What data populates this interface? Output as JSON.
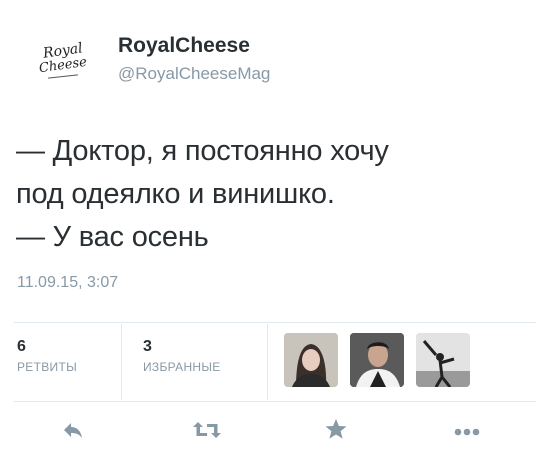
{
  "user": {
    "display_name": "RoyalCheese",
    "handle": "@RoyalCheeseMag",
    "avatar_logo_line1": "Royal",
    "avatar_logo_line2": "Cheese"
  },
  "tweet": {
    "lines": [
      "— Доктор, я постоянно хочу",
      "под одеялко и винишко.",
      "— У вас осень"
    ],
    "timestamp": "11.09.15, 3:07"
  },
  "stats": {
    "retweets_count": "6",
    "retweets_label": "РЕТВИТЫ",
    "favorites_count": "3",
    "favorites_label": "ИЗБРАННЫЕ"
  },
  "actions": {
    "icons": [
      "reply-icon",
      "retweet-icon",
      "favorite-icon",
      "more-icon"
    ]
  },
  "colors": {
    "text": "#292f33",
    "muted": "#8899a6",
    "divider": "#e1e8ed"
  }
}
